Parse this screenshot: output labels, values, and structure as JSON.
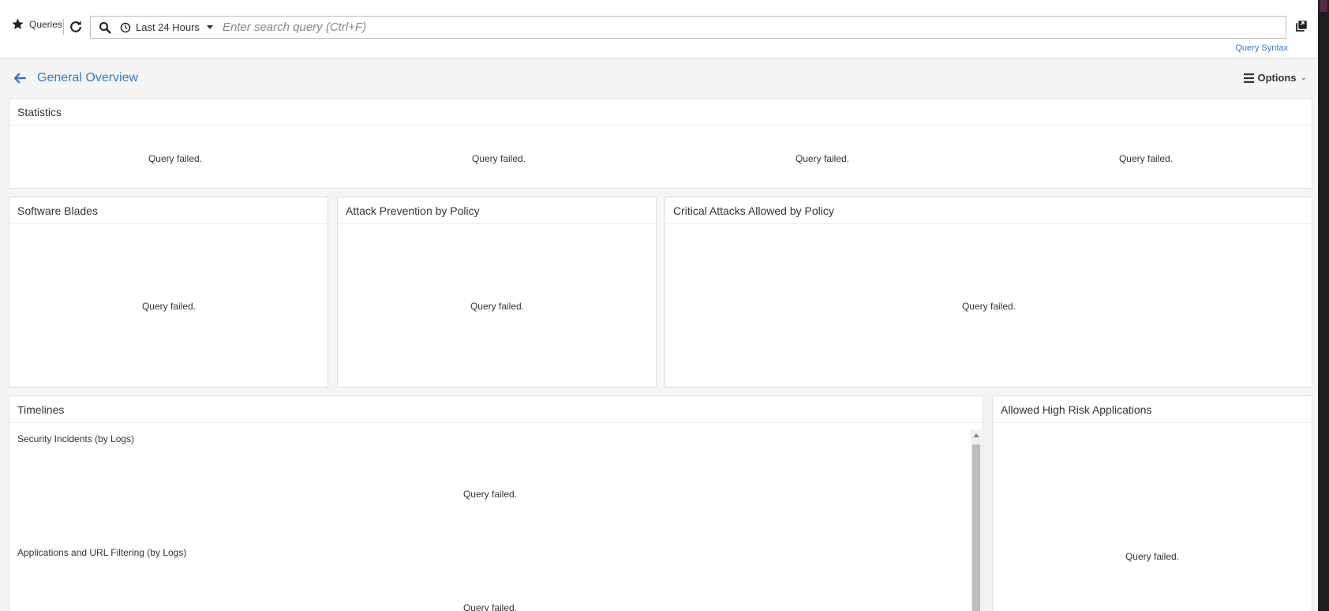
{
  "toolbar": {
    "queries_label": "Queries",
    "time_range": "Last 24 Hours",
    "search_placeholder": "Enter search query (Ctrl+F)",
    "search_value": "",
    "query_syntax_link": "Query Syntax"
  },
  "page": {
    "title": "General Overview",
    "options_label": "Options"
  },
  "statistics": {
    "title": "Statistics",
    "cells": [
      "Query failed.",
      "Query failed.",
      "Query failed.",
      "Query failed."
    ]
  },
  "software_blades": {
    "title": "Software Blades",
    "status": "Query failed."
  },
  "attack_prevention": {
    "title": "Attack Prevention by Policy",
    "status": "Query failed."
  },
  "critical_attacks": {
    "title": "Critical Attacks Allowed by Policy",
    "status": "Query failed."
  },
  "timelines": {
    "title": "Timelines",
    "sections": [
      {
        "label": "Security Incidents (by Logs)",
        "status": "Query failed."
      },
      {
        "label": "Applications and URL Filtering (by Logs)",
        "status": "Query failed."
      }
    ]
  },
  "high_risk_apps": {
    "title": "Allowed High Risk Applications",
    "status": "Query failed."
  },
  "colors": {
    "accent": "#3a79c2",
    "background": "#f5f5f5",
    "panel": "#ffffff"
  }
}
